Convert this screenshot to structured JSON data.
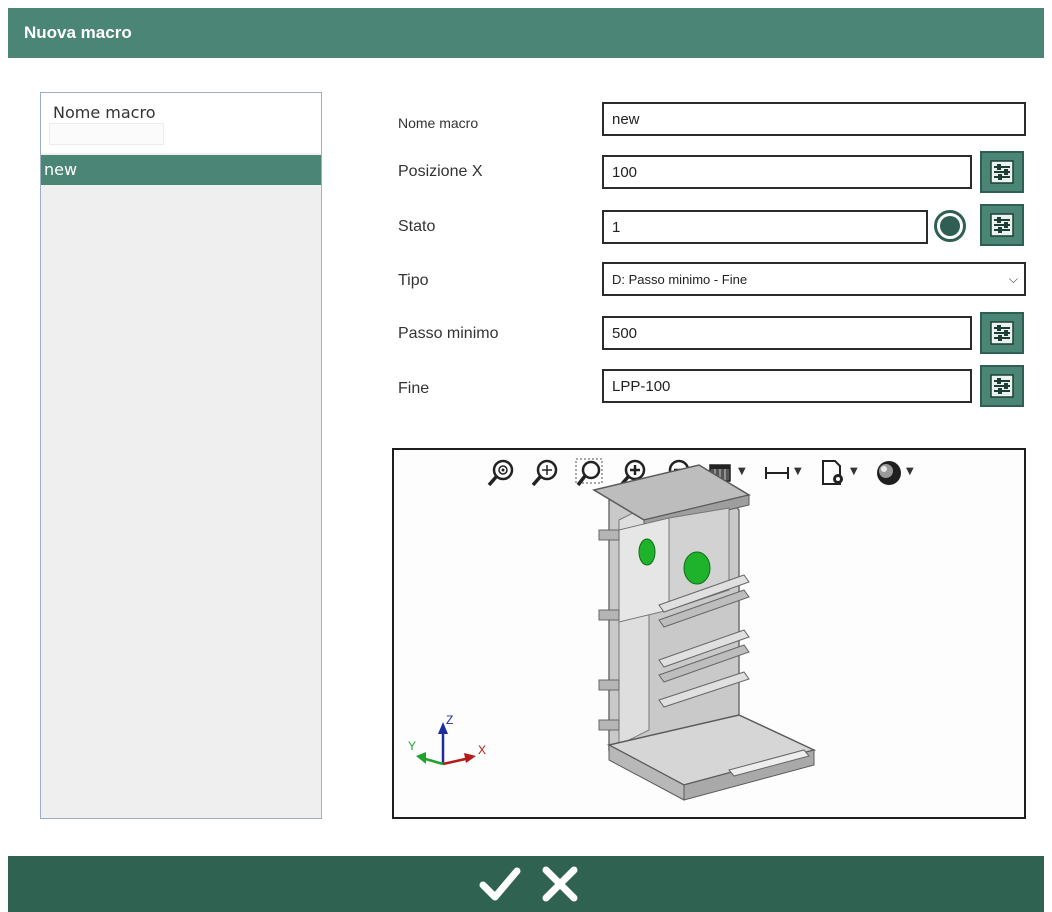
{
  "window": {
    "title": "Nuova macro"
  },
  "list": {
    "header_label": "Nome macro",
    "filter_value": "",
    "items": [
      {
        "label": "new",
        "selected": true
      }
    ]
  },
  "form": {
    "nome_macro": {
      "label": "Nome macro",
      "value": "new"
    },
    "posizione_x": {
      "label": "Posizione X",
      "value": "100"
    },
    "stato": {
      "label": "Stato",
      "value": "1"
    },
    "tipo": {
      "label": "Tipo",
      "value": "D: Passo minimo - Fine"
    },
    "passo_minimo": {
      "label": "Passo minimo",
      "value": "500"
    },
    "fine": {
      "label": "Fine",
      "value": "LPP-100"
    }
  },
  "viewer": {
    "toolbar_icons": [
      "zoom-fit-icon",
      "zoom-window-icon",
      "zoom-region-icon",
      "zoom-in-icon",
      "zoom-out-icon",
      "view-cube-icon",
      "measure-icon",
      "settings-doc-icon",
      "render-mode-icon"
    ],
    "axis_labels": {
      "x": "X",
      "y": "Y",
      "z": "Z"
    }
  },
  "actions": {
    "confirm_icon": "check-icon",
    "cancel_icon": "close-icon"
  },
  "colors": {
    "accent": "#4b8575",
    "accent_dark": "#2f6251",
    "highlight": "#1fb32c"
  }
}
